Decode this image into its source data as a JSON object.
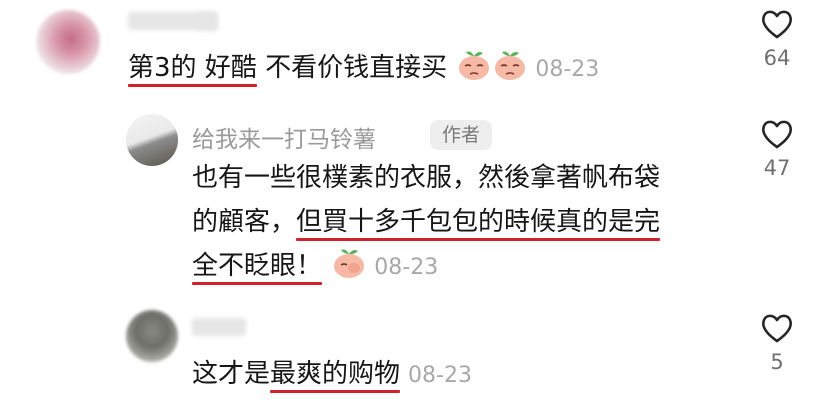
{
  "comments": [
    {
      "text_1": "第3的 好酷",
      "text_2": " 不看价钱直接买",
      "date": "08-23",
      "likes": "64",
      "emoji_icons": [
        "peach-smirk-emoji",
        "peach-smirk-emoji"
      ]
    },
    {
      "username": "给我来一打马铃薯",
      "badge": "作者",
      "line1": "也有一些很樸素的衣服，然後拿著帆布袋",
      "line2_a": "的顧客，",
      "line2_b": "但買十多千包包的時候真的是完",
      "line3_a": "全不眨眼！",
      "date": "08-23",
      "likes": "47",
      "emoji_icons": [
        "peach-facepalm-emoji"
      ]
    },
    {
      "text_1": "这才是",
      "text_2": "最爽的购物",
      "date": "08-23",
      "likes": "5"
    }
  ],
  "colors": {
    "underline": "#d0212c",
    "meta": "#a8a8a8",
    "text": "#161616"
  }
}
